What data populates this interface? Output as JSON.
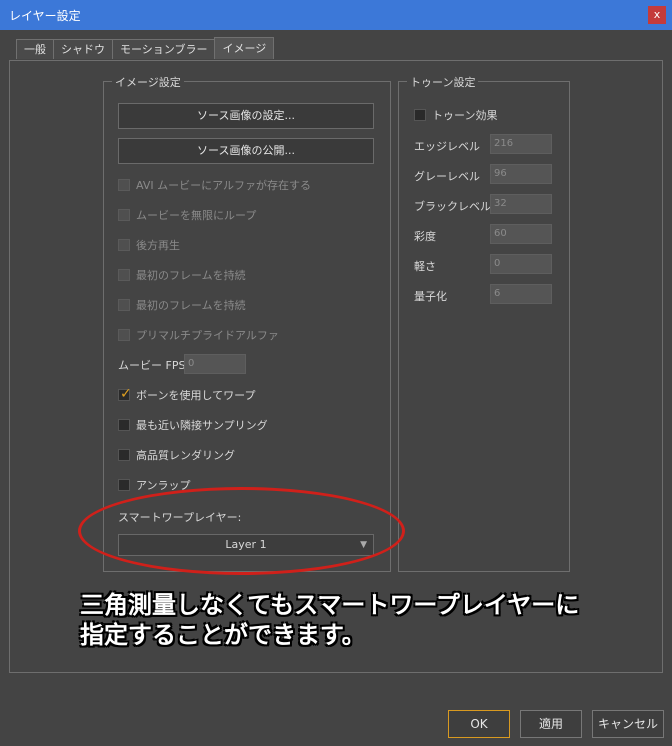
{
  "window": {
    "title": "レイヤー設定",
    "close_label": "x"
  },
  "tabs": [
    "一般",
    "シャドウ",
    "モーションブラー",
    "イメージ"
  ],
  "image_group": {
    "legend": "イメージ設定",
    "buttons": [
      "ソース画像の設定...",
      "ソース画像の公開..."
    ],
    "checkboxes": [
      {
        "label": "AVI ムービーにアルファが存在する",
        "checked": false,
        "enabled": false
      },
      {
        "label": "ムービーを無限にループ",
        "checked": false,
        "enabled": false
      },
      {
        "label": "後方再生",
        "checked": false,
        "enabled": false
      },
      {
        "label": "最初のフレームを持続",
        "checked": false,
        "enabled": false
      },
      {
        "label": "最初のフレームを持続",
        "checked": false,
        "enabled": false
      },
      {
        "label": "プリマルチプライドアルファ",
        "checked": false,
        "enabled": false
      }
    ],
    "movie_fps_label": "ムービー FPS",
    "movie_fps_value": "0",
    "checkboxes2": [
      {
        "label": "ボーンを使用してワープ",
        "checked": true,
        "enabled": true
      },
      {
        "label": "最も近い隣接サンプリング",
        "checked": false,
        "enabled": true
      },
      {
        "label": "高品質レンダリング",
        "checked": false,
        "enabled": true
      },
      {
        "label": "アンラップ",
        "checked": false,
        "enabled": true
      }
    ],
    "smart_warp_label": "スマートワープレイヤー:",
    "smart_warp_value": "Layer 1"
  },
  "toon_group": {
    "legend": "トゥーン設定",
    "toon_effect_label": "トゥーン効果",
    "fields": [
      {
        "label": "エッジレベル",
        "value": "216"
      },
      {
        "label": "グレーレベル",
        "value": "96"
      },
      {
        "label": "ブラックレベル",
        "value": "32"
      },
      {
        "label": "彩度",
        "value": "60"
      },
      {
        "label": "軽さ",
        "value": "0"
      },
      {
        "label": "量子化",
        "value": "6"
      }
    ]
  },
  "caption": [
    "三角測量しなくてもスマートワープレイヤーに",
    "指定することができます。"
  ],
  "footer": {
    "ok": "OK",
    "apply": "適用",
    "cancel": "キャンセル"
  },
  "colors": {
    "title_bar": "#3c78d8",
    "annotation": "#d0201a",
    "ok_border": "#d99a20"
  }
}
